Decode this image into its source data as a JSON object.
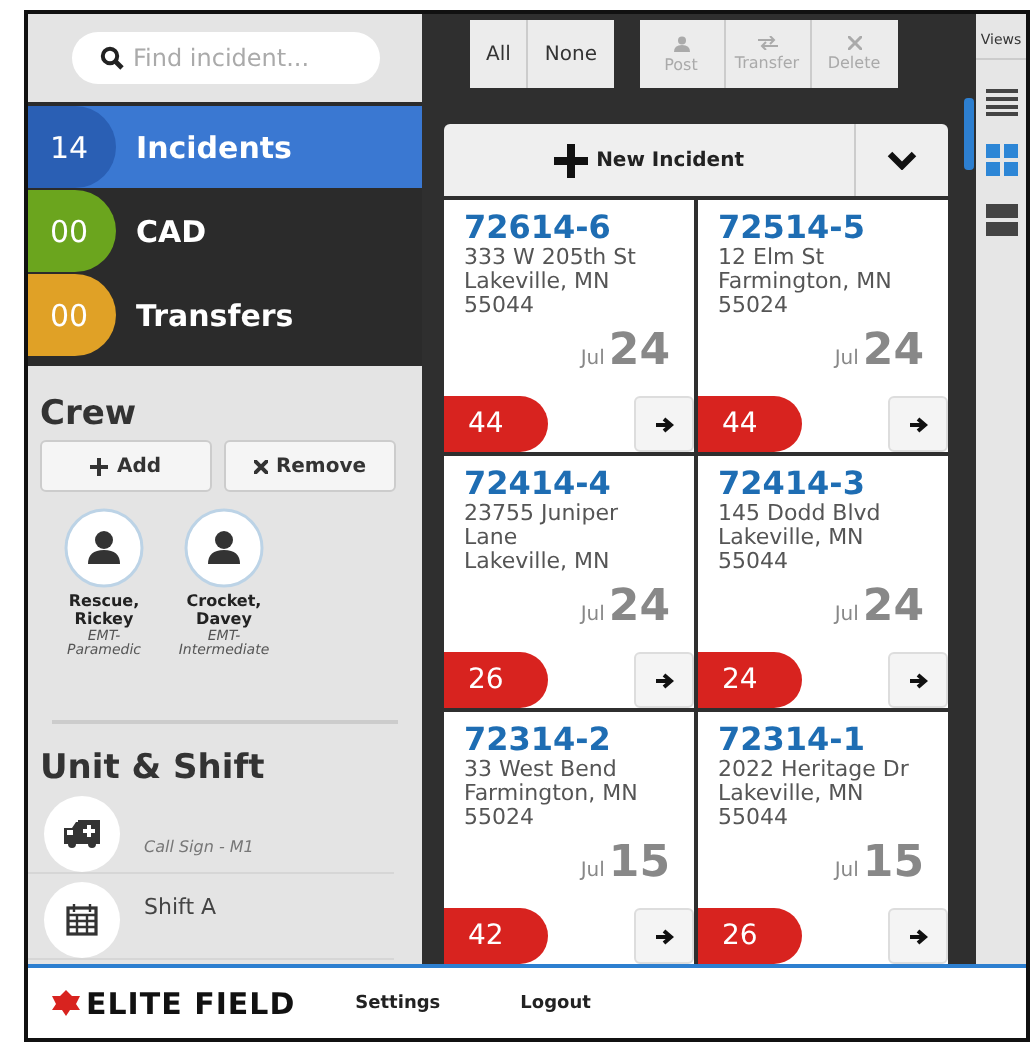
{
  "search": {
    "placeholder": "Find incident..."
  },
  "nav": [
    {
      "count": "14",
      "label": "Incidents",
      "color": "#2a5fb4",
      "selected": true
    },
    {
      "count": "00",
      "label": "CAD",
      "color": "#6ba51e",
      "selected": false
    },
    {
      "count": "00",
      "label": "Transfers",
      "color": "#e0a126",
      "selected": false
    }
  ],
  "crew": {
    "title": "Crew",
    "buttons": [
      {
        "kind": "add",
        "label": "Add"
      },
      {
        "kind": "remove",
        "label": "Remove"
      }
    ],
    "members": [
      {
        "name": "Rescue, Rickey",
        "role": "EMT-Paramedic"
      },
      {
        "name": "Crocket, Davey",
        "role": "EMT-Intermediate"
      }
    ]
  },
  "unit": {
    "title": "Unit & Shift",
    "rows": [
      {
        "kind": "unit",
        "text": "Call Sign - M1"
      },
      {
        "kind": "shift",
        "text": "Shift A"
      }
    ]
  },
  "select_buttons": [
    "All",
    "None"
  ],
  "action_buttons": [
    {
      "kind": "post",
      "label": "Post",
      "disabled": true
    },
    {
      "kind": "transfer",
      "label": "Transfer",
      "disabled": true
    },
    {
      "kind": "delete",
      "label": "Delete",
      "disabled": true
    }
  ],
  "new_incident": {
    "label": "New Incident"
  },
  "incidents": [
    {
      "id": "72614-6",
      "address": [
        "333 W 205th St",
        "Lakeville, MN",
        "55044"
      ],
      "month": "Jul",
      "day": "24",
      "badge": "44"
    },
    {
      "id": "72514-5",
      "address": [
        "12 Elm St",
        "Farmington, MN",
        "55024"
      ],
      "month": "Jul",
      "day": "24",
      "badge": "44"
    },
    {
      "id": "72414-4",
      "address": [
        "23755 Juniper",
        "Lane",
        "Lakeville, MN"
      ],
      "month": "Jul",
      "day": "24",
      "badge": "26"
    },
    {
      "id": "72414-3",
      "address": [
        "145 Dodd Blvd",
        "Lakeville, MN",
        "55044"
      ],
      "month": "Jul",
      "day": "24",
      "badge": "24"
    },
    {
      "id": "72314-2",
      "address": [
        "33 West Bend",
        "Farmington, MN",
        "55024"
      ],
      "month": "Jul",
      "day": "15",
      "badge": "42"
    },
    {
      "id": "72314-1",
      "address": [
        "2022 Heritage Dr",
        "Lakeville, MN",
        "55044"
      ],
      "month": "Jul",
      "day": "15",
      "badge": "26"
    }
  ],
  "views": {
    "title": "Views",
    "options": [
      {
        "kind": "list",
        "selected": false
      },
      {
        "kind": "grid",
        "selected": true
      },
      {
        "kind": "split",
        "selected": false
      }
    ]
  },
  "footer": {
    "logo": "ELITE FIELD",
    "links": [
      "Settings",
      "Logout"
    ]
  }
}
